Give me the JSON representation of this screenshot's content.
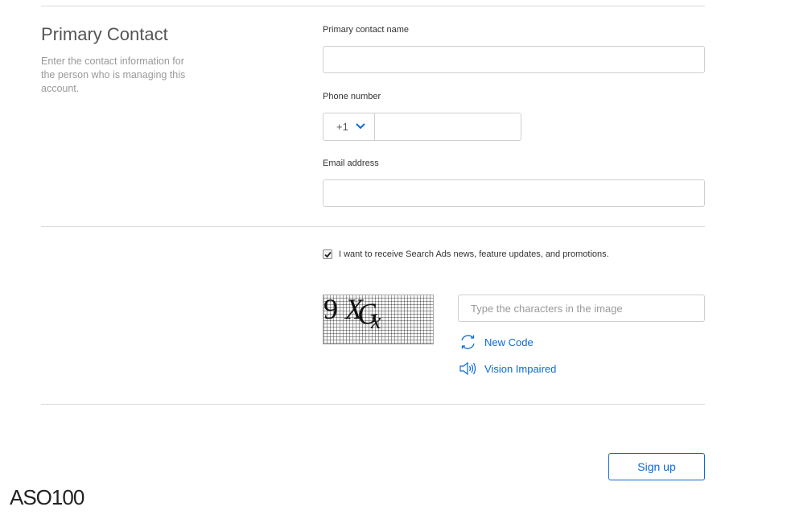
{
  "section": {
    "title": "Primary Contact",
    "description": "Enter the contact information for the person who is managing this account."
  },
  "fields": {
    "name_label": "Primary contact name",
    "name_value": "",
    "phone_label": "Phone number",
    "country_code": "+1",
    "phone_value": "",
    "email_label": "Email address",
    "email_value": ""
  },
  "optin": {
    "label": "I want to receive Search Ads news, feature updates, and promotions.",
    "checked": true
  },
  "captcha": {
    "input_placeholder": "Type the characters in the image",
    "new_code_label": "New Code",
    "vision_impaired_label": "Vision Impaired"
  },
  "actions": {
    "signup_label": "Sign up"
  },
  "watermark": "ASO100",
  "colors": {
    "accent": "#0a6bd6",
    "border": "#cfcfcf",
    "divider": "#dcdcdc"
  }
}
